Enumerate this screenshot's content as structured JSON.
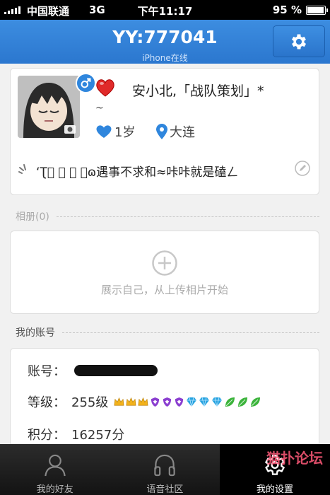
{
  "status_bar": {
    "carrier": "中国联通",
    "network": "3G",
    "time": "下午11:17",
    "battery_pct": "95 %",
    "battery_level": 0.95
  },
  "nav": {
    "title": "YY:777041",
    "subtitle": "iPhone在线",
    "settings_icon": "gear-icon"
  },
  "profile": {
    "name": "安小北,「战队策划」*",
    "name_tail": "~",
    "age": "1岁",
    "location": "大连",
    "signature": "ʻƮ⃣ ⃣ ⃣ ⃣ɷ遇事不求和≈咔咔就是磕ㄥ",
    "gender_icon": "male-icon",
    "accent_color": "#2f86dd"
  },
  "album": {
    "header": "相册(0)",
    "empty_tip": "展示自己，从上传相片开始"
  },
  "account": {
    "header": "我的账号",
    "account_label": "账号：",
    "level_label": "等级：",
    "level_value": "255级",
    "points_label": "积分：",
    "points_value": "16257分",
    "badges": [
      "crown",
      "crown",
      "crown",
      "shield",
      "shield",
      "shield",
      "diamond",
      "diamond",
      "diamond",
      "leaf",
      "leaf",
      "leaf"
    ]
  },
  "tabs": [
    {
      "label": "我的好友",
      "icon": "person-icon"
    },
    {
      "label": "语音社区",
      "icon": "headphones-icon"
    },
    {
      "label": "我的设置",
      "icon": "gear-icon"
    }
  ],
  "watermark": "猫扑论坛"
}
